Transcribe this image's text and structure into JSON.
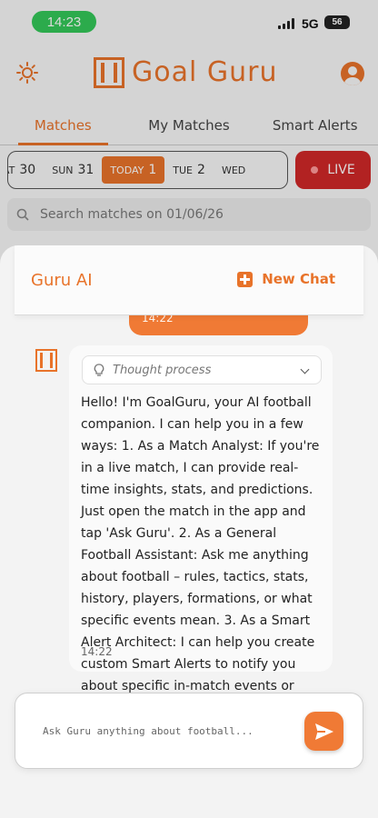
{
  "status_bar": {
    "time": "14:23",
    "network": "5G",
    "battery": "56"
  },
  "header": {
    "app_name": "Goal Guru"
  },
  "tabs": [
    {
      "label": "Matches",
      "active": true
    },
    {
      "label": "My Matches",
      "active": false
    },
    {
      "label": "Smart Alerts",
      "active": false
    }
  ],
  "dates": [
    {
      "day": "AT",
      "num": "30"
    },
    {
      "day": "SUN",
      "num": "31"
    },
    {
      "day": "TODAY",
      "num": "1"
    },
    {
      "day": "TUE",
      "num": "2"
    },
    {
      "day": "WED",
      "num": ""
    }
  ],
  "live_label": "LIVE",
  "search": {
    "placeholder": "Search matches on 01/06/26"
  },
  "chat": {
    "title": "Guru AI",
    "new_chat_label": "New Chat",
    "user_message_time": "14:22",
    "thought_label": "Thought process",
    "bot_message": "Hello! I'm GoalGuru, your AI football companion. I can help you in a few ways: 1. As a Match Analyst: If you're in a live match, I can provide real-time insights, stats, and predictions. Just open the match in the app and tap 'Ask Guru'. 2. As a General Football Assistant: Ask me anything about football – rules, tactics, stats, history, players, formations, or what specific events mean. 3. As a Smart Alert Architect: I can help you create custom Smart Alerts to notify you about specific in-match events or patterns, like momentum shifts or dangerous attacks. What can I help you with today?",
    "bot_message_time": "14:22",
    "input_placeholder": "Ask Guru anything about football..."
  },
  "colors": {
    "accent": "#e8732a",
    "live": "#d02828",
    "status_pill": "#34c759"
  },
  "icons": [
    "sun-icon",
    "profile-icon",
    "search-icon",
    "new-chat-icon",
    "bot-avatar-icon",
    "lightbulb-icon",
    "chevron-down-icon",
    "send-icon"
  ]
}
